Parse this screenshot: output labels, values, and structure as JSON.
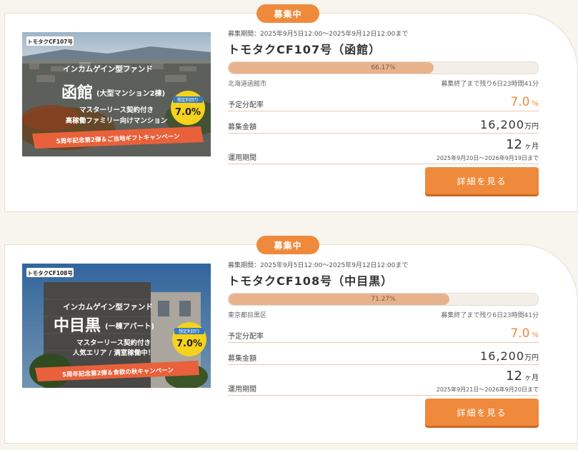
{
  "colors": {
    "accent": "#ef8a3c",
    "progress_fill": "#e8b38c",
    "background": "#f7f5ee"
  },
  "funds": [
    {
      "status": "募集中",
      "thumb": {
        "tag": "トモタクCF107号",
        "line1": "インカムゲイン型ファンド",
        "big": "函館",
        "big_sub": "(大型マンション2棟)",
        "line3": "マスターリース契約付き",
        "line4": "高稼働ファミリー向けマンション",
        "badge_top": "想定利回り",
        "badge_val": "7.0%",
        "ribbon": "5周年記念第2弾＆ご当地ギフトキャンペーン"
      },
      "period": "募集期間：2025年9月5日12:00〜2025年9月12日12:00まで",
      "name": "トモタクCF107号（函館）",
      "progress": 66.17,
      "progress_label": "66.17%",
      "location": "北海道函館市",
      "remaining": "募集終了まで残り6日23時間41分",
      "yield_label": "予定分配率",
      "yield_value": "7.0",
      "yield_unit": "%",
      "amount_label": "募集金額",
      "amount_value": "16,200",
      "amount_unit": "万円",
      "term_label": "運用期間",
      "term_value": "12",
      "term_unit": "ヶ月",
      "term_dates": "2025年9月20日〜2026年9月19日まで",
      "button": "詳細を見る"
    },
    {
      "status": "募集中",
      "thumb": {
        "tag": "トモタクCF108号",
        "line1": "インカムゲイン型ファンド",
        "big": "中目黒",
        "big_sub": "(一棟アパート)",
        "line3": "マスターリース契約付き",
        "line4": "人気エリア / 満室稼働中！",
        "badge_top": "想定利回り",
        "badge_val": "7.0%",
        "ribbon": "5周年記念第2弾＆食欲の秋キャンペーン"
      },
      "period": "募集期間：2025年9月5日12:00〜2025年9月12日12:00まで",
      "name": "トモタクCF108号（中目黒）",
      "progress": 71.27,
      "progress_label": "71.27%",
      "location": "東京都目黒区",
      "remaining": "募集終了まで残り6日23時間41分",
      "yield_label": "予定分配率",
      "yield_value": "7.0",
      "yield_unit": "%",
      "amount_label": "募集金額",
      "amount_value": "16,200",
      "amount_unit": "万円",
      "term_label": "運用期間",
      "term_value": "12",
      "term_unit": "ヶ月",
      "term_dates": "2025年9月21日〜2026年9月20日まで",
      "button": "詳細を見る"
    }
  ]
}
